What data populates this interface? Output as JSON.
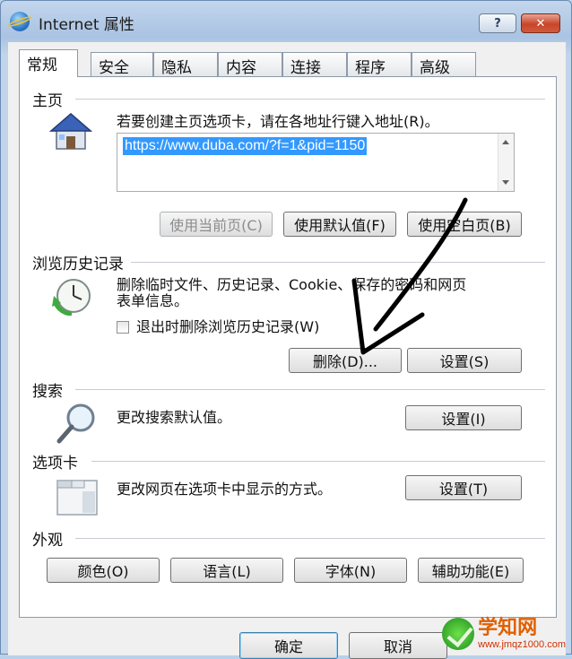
{
  "window": {
    "title": "Internet 属性",
    "help_label": "?",
    "close_label": "✕"
  },
  "tabs": [
    {
      "label": "常规",
      "active": true
    },
    {
      "label": "安全"
    },
    {
      "label": "隐私"
    },
    {
      "label": "内容"
    },
    {
      "label": "连接"
    },
    {
      "label": "程序"
    },
    {
      "label": "高级"
    }
  ],
  "home": {
    "heading": "主页",
    "description": "若要创建主页选项卡，请在各地址行键入地址(R)。",
    "url": "https://www.duba.com/?f=1&pid=1150",
    "use_current": "使用当前页(C)",
    "use_default": "使用默认值(F)",
    "use_blank": "使用空白页(B)"
  },
  "history": {
    "heading": "浏览历史记录",
    "description_line1": "删除临时文件、历史记录、Cookie、保存的密码和网页",
    "description_line2": "表单信息。",
    "checkbox_label": "退出时删除浏览历史记录(W)",
    "checkbox_checked": false,
    "delete_button": "删除(D)...",
    "settings_button": "设置(S)"
  },
  "search": {
    "heading": "搜索",
    "description": "更改搜索默认值。",
    "settings_button": "设置(I)"
  },
  "tabbed": {
    "heading": "选项卡",
    "description": "更改网页在选项卡中显示的方式。",
    "settings_button": "设置(T)"
  },
  "appearance": {
    "heading": "外观",
    "colors": "颜色(O)",
    "languages": "语言(L)",
    "fonts": "字体(N)",
    "accessibility": "辅助功能(E)"
  },
  "footer": {
    "ok": "确定",
    "cancel": "取消"
  },
  "watermark": {
    "brand": "学知网",
    "site": "www.jmqz1000.com"
  },
  "icons": [
    "internet-globe-icon",
    "house-icon",
    "clock-refresh-icon",
    "magnifier-icon",
    "tabs-window-icon",
    "annotation-arrow"
  ]
}
